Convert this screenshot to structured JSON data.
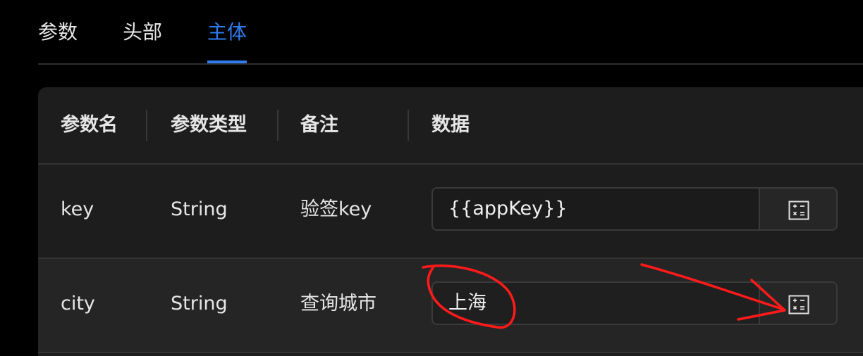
{
  "tabs": [
    {
      "label": "参数"
    },
    {
      "label": "头部"
    },
    {
      "label": "主体"
    }
  ],
  "active_tab": "主体",
  "accent_color": "#2f7cf0",
  "annotation_color": "#ff1a1a",
  "table": {
    "headers": [
      "参数名",
      "参数类型",
      "备注",
      "数据"
    ],
    "rows": [
      {
        "name": "key",
        "type": "String",
        "note": "验签key",
        "value": "{{appKey}}",
        "action_icon": "calculator-icon"
      },
      {
        "name": "city",
        "type": "String",
        "note": "查询城市",
        "value": "上海",
        "action_icon": "calculator-icon"
      }
    ]
  }
}
